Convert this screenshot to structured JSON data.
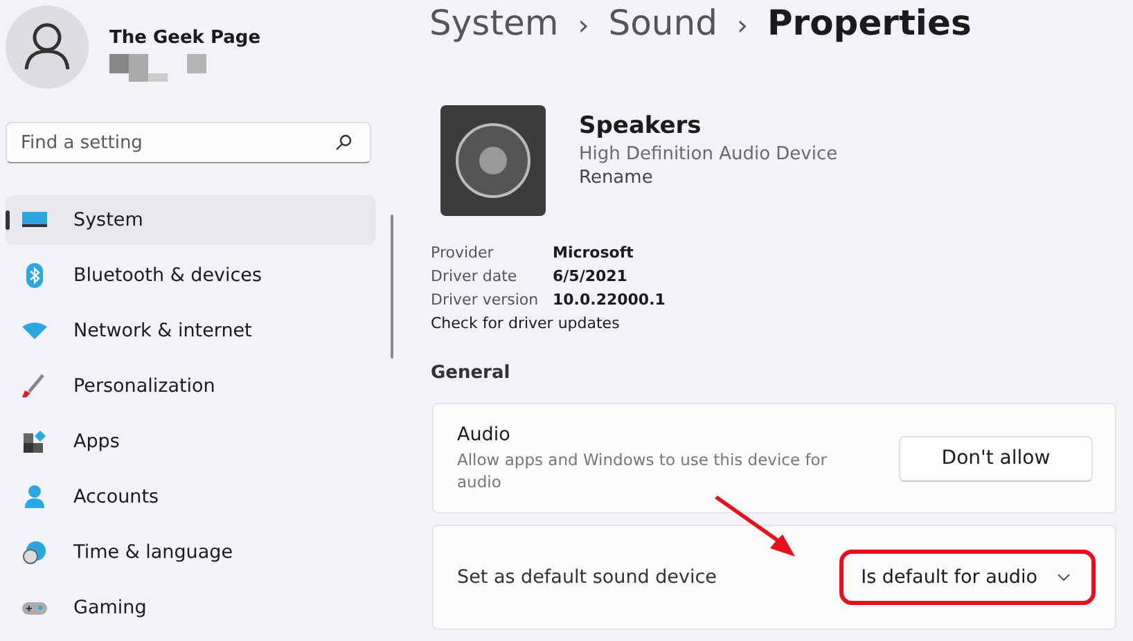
{
  "account": {
    "name": "The Geek Page"
  },
  "search": {
    "placeholder": "Find a setting"
  },
  "sidebar": {
    "items": [
      {
        "label": "System",
        "selected": true
      },
      {
        "label": "Bluetooth & devices",
        "selected": false
      },
      {
        "label": "Network & internet",
        "selected": false
      },
      {
        "label": "Personalization",
        "selected": false
      },
      {
        "label": "Apps",
        "selected": false
      },
      {
        "label": "Accounts",
        "selected": false
      },
      {
        "label": "Time & language",
        "selected": false
      },
      {
        "label": "Gaming",
        "selected": false
      }
    ]
  },
  "breadcrumb": [
    "System",
    "Sound",
    "Properties"
  ],
  "breadcrumb_separator": "›",
  "device": {
    "name": "Speakers",
    "description": "High Definition Audio Device",
    "rename": "Rename"
  },
  "properties": [
    {
      "label": "Provider",
      "value": "Microsoft"
    },
    {
      "label": "Driver date",
      "value": "6/5/2021"
    },
    {
      "label": "Driver version",
      "value": "10.0.22000.1"
    }
  ],
  "update_link": "Check for driver updates",
  "section_title": "General",
  "audio_card": {
    "title": "Audio",
    "description": "Allow apps and Windows to use this device for audio",
    "button": "Don't allow"
  },
  "default_card": {
    "title": "Set as default sound device",
    "value": "Is default for audio",
    "highlighted": true
  }
}
